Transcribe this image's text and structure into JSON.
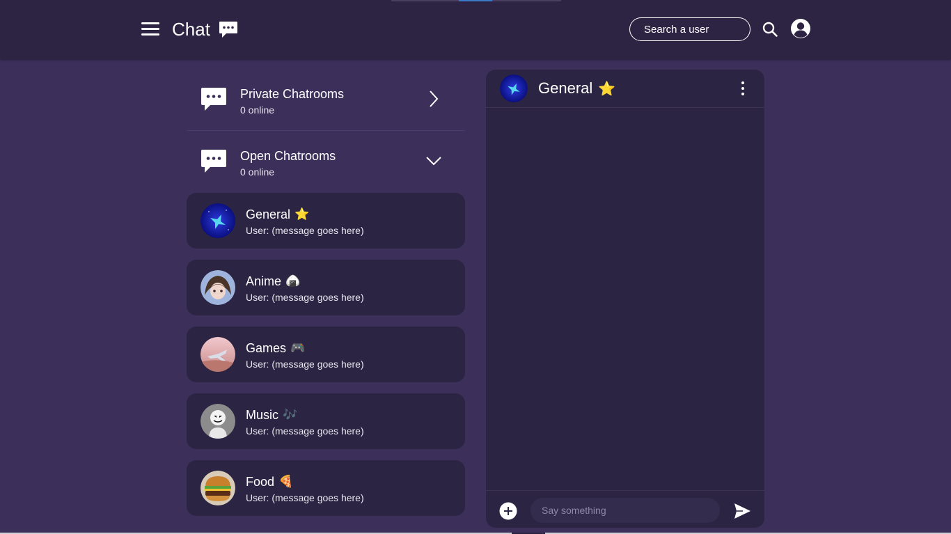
{
  "header": {
    "app_title": "Chat",
    "menu_icon": "hamburger-menu-icon",
    "title_icon": "chat-bubble-icon",
    "search_placeholder": "Search a user",
    "search_icon": "search-icon",
    "profile_icon": "user-account-icon"
  },
  "categories": [
    {
      "title": "Private Chatrooms",
      "subtitle": "0 online",
      "icon": "chat-bubble-icon",
      "arrow": "chevron-right-icon"
    },
    {
      "title": "Open Chatrooms",
      "subtitle": "0 online",
      "icon": "chat-bubble-icon",
      "arrow": "chevron-down-icon"
    }
  ],
  "rooms": [
    {
      "name": "General",
      "emoji": "⭐",
      "message": "User: (message goes here)"
    },
    {
      "name": "Anime",
      "emoji": "🍙",
      "message": "User: (message goes here)"
    },
    {
      "name": "Games",
      "emoji": "🎮",
      "message": "User: (message goes here)"
    },
    {
      "name": "Music",
      "emoji": "🎶",
      "message": "User: (message goes here)"
    },
    {
      "name": "Food",
      "emoji": "🍕",
      "message": "User: (message goes here)"
    }
  ],
  "chat": {
    "title": "General",
    "title_emoji": "⭐",
    "menu_icon": "more-vertical-icon",
    "input_placeholder": "Say something",
    "add_icon": "plus-circle-icon",
    "send_icon": "send-icon"
  },
  "colors": {
    "background": "#3c2f5a",
    "header": "#2d2443",
    "card": "#2b2442",
    "text": "#ffffff",
    "star": "#f6c233"
  }
}
